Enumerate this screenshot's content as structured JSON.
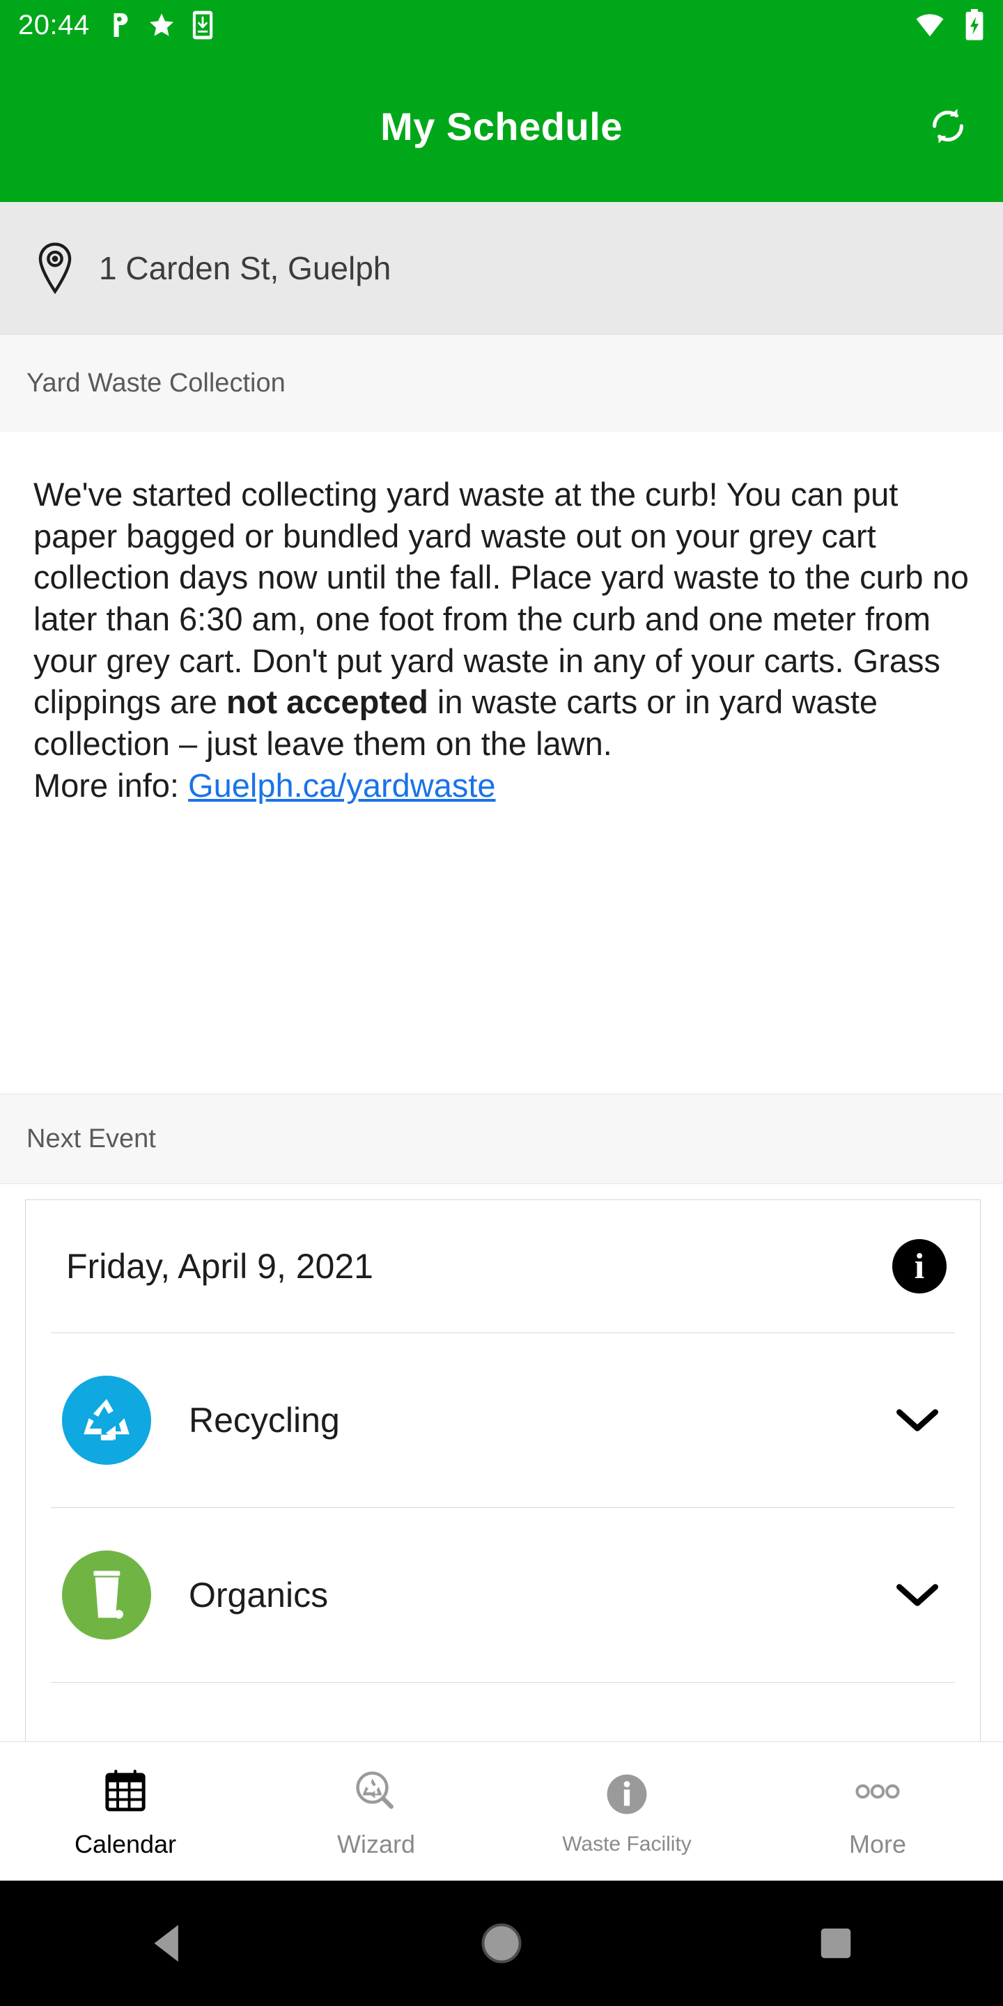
{
  "status_bar": {
    "time": "20:44",
    "left_icons": [
      "pandora-icon",
      "star-icon",
      "phone-download-icon"
    ],
    "right_icons": [
      "wifi-icon",
      "battery-charging-icon"
    ],
    "background_color": "#00A819"
  },
  "app_bar": {
    "title": "My Schedule",
    "action_icon": "refresh-icon",
    "background_color": "#00A819",
    "text_color": "#FFFFFF"
  },
  "address_bar": {
    "icon": "location-pin-icon",
    "address": "1 Carden St, Guelph",
    "background_color": "#E9E9E9"
  },
  "notice": {
    "section_label": "Yard Waste Collection",
    "paragraph_part1": "We've started collecting yard waste at the curb! You can put paper bagged or bundled yard waste out on your grey cart collection days now until the fall. Place yard waste to the curb no later than 6:30 am, one foot from the curb and one meter from your grey cart. Don't put yard waste in any of your carts. Grass clippings are ",
    "bold_text": "not accepted",
    "paragraph_part2": " in waste carts or in yard waste collection – just leave them on the lawn.",
    "more_info_label": "More info: ",
    "link_text": "Guelph.ca/yardwaste",
    "link_color": "#1A73E8"
  },
  "next_event": {
    "section_label": "Next Event",
    "date": "Friday, April 9, 2021",
    "info_icon": "info-icon",
    "collections": [
      {
        "name": "Recycling",
        "icon": "recycling-icon",
        "color": "#0FA8E0",
        "expand_icon": "chevron-down-icon"
      },
      {
        "name": "Organics",
        "icon": "organics-cart-icon",
        "color": "#70B544",
        "expand_icon": "chevron-down-icon"
      }
    ]
  },
  "bottom_nav": {
    "items": [
      {
        "label": "Calendar",
        "icon": "calendar-icon",
        "active": true
      },
      {
        "label": "Wizard",
        "icon": "waste-wizard-icon",
        "active": false
      },
      {
        "label": "Waste Facility",
        "icon": "info-circle-icon",
        "active": false
      },
      {
        "label": "More",
        "icon": "more-dots-icon",
        "active": false
      }
    ]
  },
  "android_nav": {
    "back": "back-triangle-icon",
    "home": "home-circle-icon",
    "recents": "recents-square-icon"
  }
}
